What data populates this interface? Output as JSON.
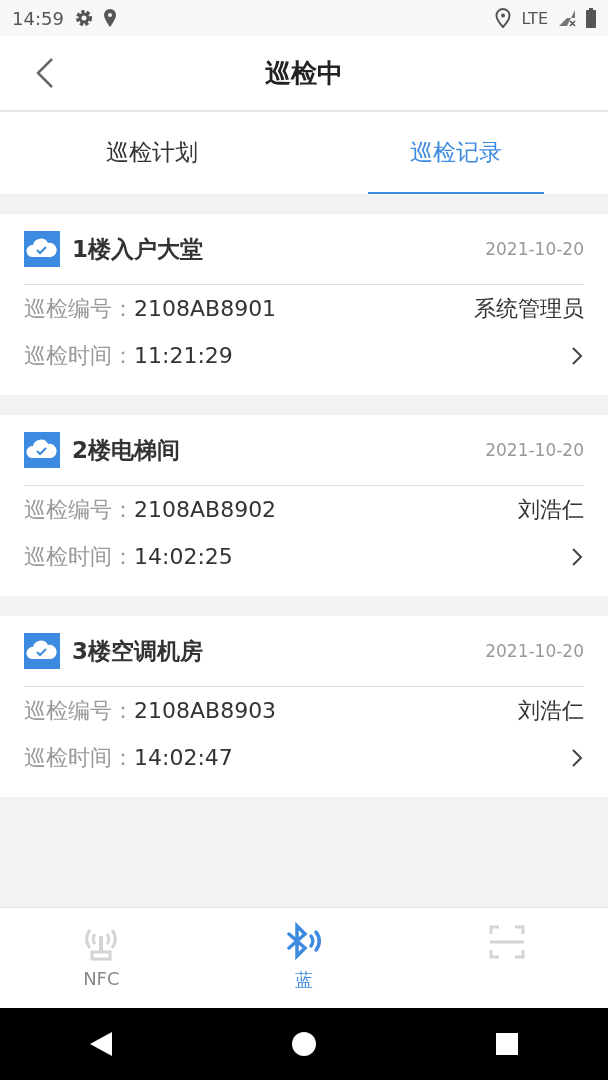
{
  "status_bar": {
    "time": "14:59",
    "network": "LTE"
  },
  "header": {
    "title": "巡检中"
  },
  "tabs": [
    {
      "label": "巡检计划",
      "selected": false
    },
    {
      "label": "巡检记录",
      "selected": true
    }
  ],
  "records": [
    {
      "name": "1楼入户大堂",
      "date": "2021-10-20",
      "number_label": "巡检编号：",
      "number": "2108AB8901",
      "inspector": "系统管理员",
      "time_label": "巡检时间：",
      "time": "11:21:29"
    },
    {
      "name": "2楼电梯间",
      "date": "2021-10-20",
      "number_label": "巡检编号：",
      "number": "2108AB8902",
      "inspector": "刘浩仁",
      "time_label": "巡检时间：",
      "time": "14:02:25"
    },
    {
      "name": "3楼空调机房",
      "date": "2021-10-20",
      "number_label": "巡检编号：",
      "number": "2108AB8903",
      "inspector": "刘浩仁",
      "time_label": "巡检时间：",
      "time": "14:02:47"
    }
  ],
  "bottom_nav": [
    {
      "kind": "nfc",
      "label": "NFC",
      "selected": false
    },
    {
      "kind": "bluetooth",
      "label": "蓝",
      "selected": true
    },
    {
      "kind": "scan",
      "selected": false
    }
  ]
}
